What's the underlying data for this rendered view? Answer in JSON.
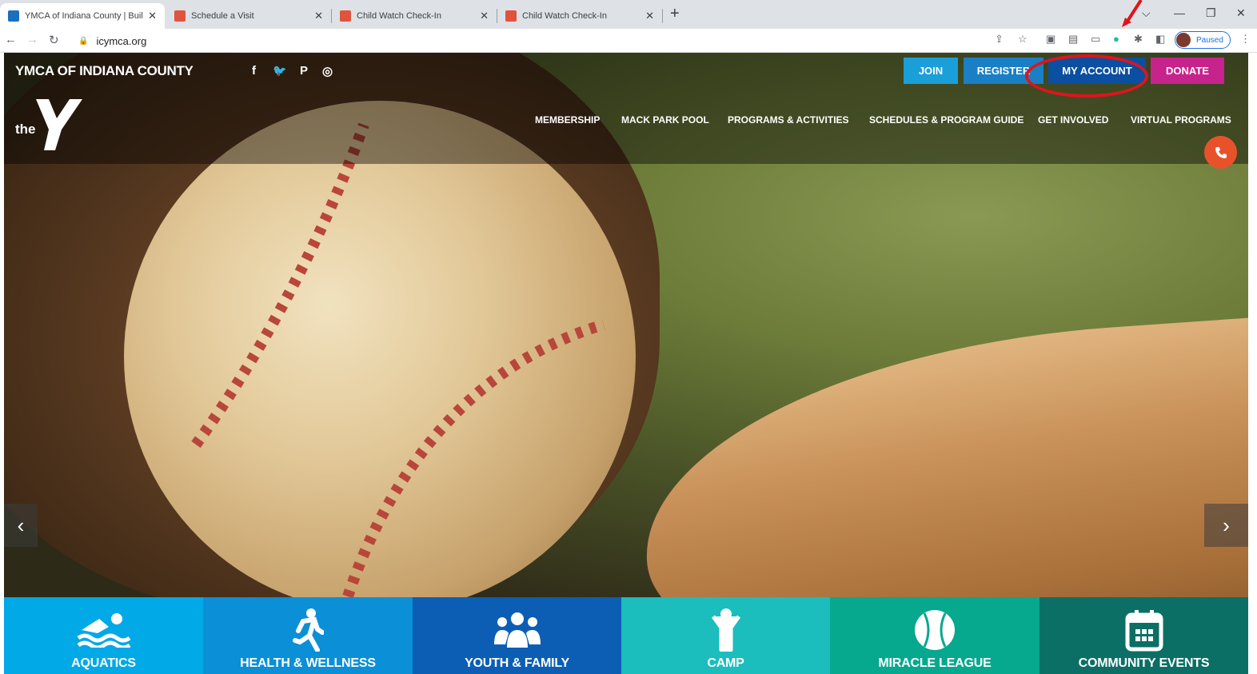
{
  "browser": {
    "tabs": [
      {
        "title": "YMCA of Indiana County | Building ...",
        "favicon_color": "#1a6fbf",
        "active": true
      },
      {
        "title": "Schedule a Visit",
        "favicon_color": "#e0533d",
        "active": false
      },
      {
        "title": "Child Watch Check-In",
        "favicon_color": "#e0533d",
        "active": false
      },
      {
        "title": "Child Watch Check-In",
        "favicon_color": "#e0533d",
        "active": false
      }
    ],
    "close_glyph": "✕",
    "new_tab_glyph": "+",
    "url": "icymca.org",
    "profile_status": "Paused"
  },
  "site": {
    "name": "YMCA OF INDIANA COUNTY",
    "logo_text": "the",
    "social": [
      "f",
      "🐦",
      "P",
      "◎"
    ],
    "top_buttons": [
      {
        "label": "JOIN",
        "color": "#1a9fd9"
      },
      {
        "label": "REGISTER",
        "color": "#1a7fc4"
      },
      {
        "label": "MY ACCOUNT",
        "color": "#0a4fa0"
      },
      {
        "label": "DONATE",
        "color": "#c7238c"
      }
    ],
    "nav": [
      "MEMBERSHIP",
      "MACK PARK POOL",
      "PROGRAMS & ACTIVITIES",
      "SCHEDULES & PROGRAM GUIDE",
      "GET INVOLVED",
      "VIRTUAL PROGRAMS"
    ],
    "phone_color": "#e8522b",
    "slider_prev": "‹",
    "slider_next": "›",
    "tiles": [
      {
        "label": "AQUATICS",
        "color": "#01a9e6",
        "icon": "swimmer-icon"
      },
      {
        "label": "HEALTH & WELLNESS",
        "color": "#0b8fd6",
        "icon": "runner-icon"
      },
      {
        "label": "YOUTH & FAMILY",
        "color": "#0b5eb4",
        "icon": "family-icon"
      },
      {
        "label": "CAMP",
        "color": "#1bbdbd",
        "icon": "camper-icon"
      },
      {
        "label": "MIRACLE LEAGUE",
        "color": "#06a88e",
        "icon": "baseball-icon"
      },
      {
        "label": "COMMUNITY EVENTS",
        "color": "#0b6f66",
        "icon": "calendar-icon"
      }
    ],
    "annotation_color": "#e0141c"
  }
}
